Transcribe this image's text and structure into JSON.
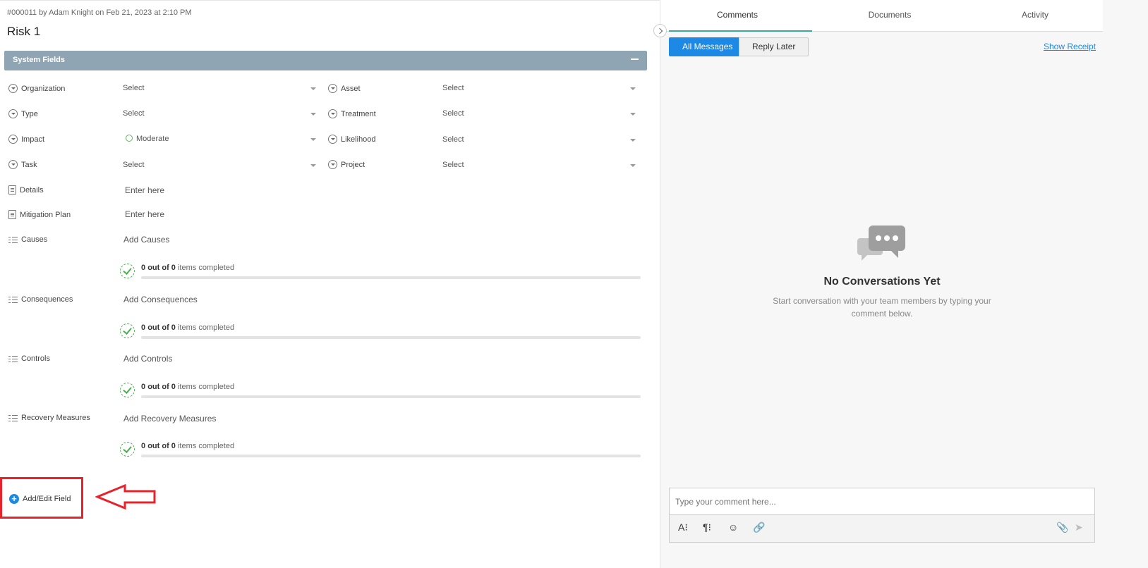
{
  "record": {
    "meta": "#000011 by Adam Knight on Feb 21, 2023 at 2:10 PM",
    "title": "Risk 1"
  },
  "section": {
    "label": "System Fields"
  },
  "fields": {
    "organization": {
      "label": "Organization",
      "value": "Select"
    },
    "asset": {
      "label": "Asset",
      "value": "Select"
    },
    "type": {
      "label": "Type",
      "value": "Select"
    },
    "treatment": {
      "label": "Treatment",
      "value": "Select"
    },
    "impact": {
      "label": "Impact",
      "value": "Moderate"
    },
    "likelihood": {
      "label": "Likelihood",
      "value": "Select"
    },
    "task": {
      "label": "Task",
      "value": "Select"
    },
    "project": {
      "label": "Project",
      "value": "Select"
    },
    "details": {
      "label": "Details",
      "placeholder": "Enter here"
    },
    "mitigation": {
      "label": "Mitigation Plan",
      "placeholder": "Enter here"
    }
  },
  "checklists": {
    "causes": {
      "label": "Causes",
      "add": "Add Causes",
      "done": "0",
      "of": "out of",
      "total": "0",
      "suffix": "items completed",
      "progress": 0
    },
    "consequences": {
      "label": "Consequences",
      "add": "Add Consequences",
      "done": "0",
      "of": "out of",
      "total": "0",
      "suffix": "items completed",
      "progress": 0
    },
    "controls": {
      "label": "Controls",
      "add": "Add Controls",
      "done": "0",
      "of": "out of",
      "total": "0",
      "suffix": "items completed",
      "progress": 0
    },
    "recovery": {
      "label": "Recovery Measures",
      "add": "Add Recovery Measures",
      "done": "0",
      "of": "out of",
      "total": "0",
      "suffix": "items completed",
      "progress": 0
    }
  },
  "add_edit_field": {
    "label": "Add/Edit Field"
  },
  "right_panel": {
    "tabs": [
      "Comments",
      "Documents",
      "Activity"
    ],
    "active_tab": "Comments",
    "filters": {
      "all": "All Messages",
      "later": "Reply Later"
    },
    "show_receipt": "Show Receipt",
    "empty_title": "No Conversations Yet",
    "empty_text": "Start conversation with your team members by typing your comment below.",
    "composer_placeholder": "Type your comment here..."
  },
  "colors": {
    "accent": "#1e88e5",
    "section_bar": "#8fa5b3",
    "highlight": "#e8222a",
    "success": "#4caf50",
    "tab_underline": "#3aa99f"
  }
}
